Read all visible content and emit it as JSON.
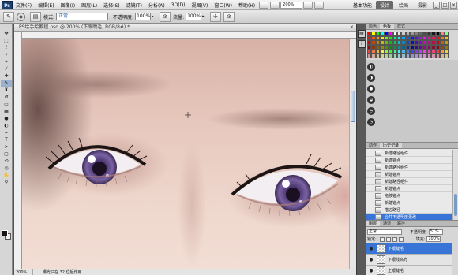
{
  "app": {
    "logo": "Ps",
    "menu": [
      "文件(F)",
      "编辑(E)",
      "图像(I)",
      "图层(L)",
      "选择(S)",
      "滤镜(T)",
      "分析(A)",
      "3D(D)",
      "视图(V)",
      "窗口(W)",
      "帮助(H)"
    ],
    "zoom_select": "200%",
    "workspace_label": "基本功能",
    "workspace_tabs": [
      "设计",
      "绘画",
      "摄影"
    ],
    "window_controls": [
      "_",
      "□",
      "×"
    ]
  },
  "options": {
    "mode_label": "模式:",
    "mode_value": "正常",
    "opacity_label": "不透明度:",
    "opacity_value": "100%",
    "flow_label": "流量:",
    "flow_value": "100%"
  },
  "document": {
    "tab_title": "PS绘手绘教程.psd @ 200% (下眼睫毛, RGB/8#) *",
    "status_zoom": "200%",
    "status_info": "曝光只在 32 位起作用"
  },
  "panels": {
    "swatches_tabs": [
      "颜色",
      "色板",
      "样式"
    ],
    "history_tabs": [
      "动作",
      "历史记录"
    ],
    "history_items": [
      "新建路径组件",
      "新建锚点",
      "新建路径组件",
      "新建锚点",
      "新建路径组件",
      "新建锚点",
      "拖移锚点",
      "新建锚点",
      "描边路径",
      "合并不透明度更改"
    ],
    "history_active_index": 9,
    "layers_tabs": [
      "图层",
      "通道",
      "路径"
    ],
    "blend_mode": "正常",
    "opacity_label": "不透明度:",
    "opacity_value": "51%",
    "lock_label": "锁定:",
    "fill_label": "填充:",
    "fill_value": "100%",
    "layers": [
      "下眼睫毛",
      "下眼线高光",
      "上眼睫毛"
    ],
    "active_layer_index": 0
  },
  "colors": {
    "selection": "#3875d7",
    "iris": "#6a4f8f"
  }
}
